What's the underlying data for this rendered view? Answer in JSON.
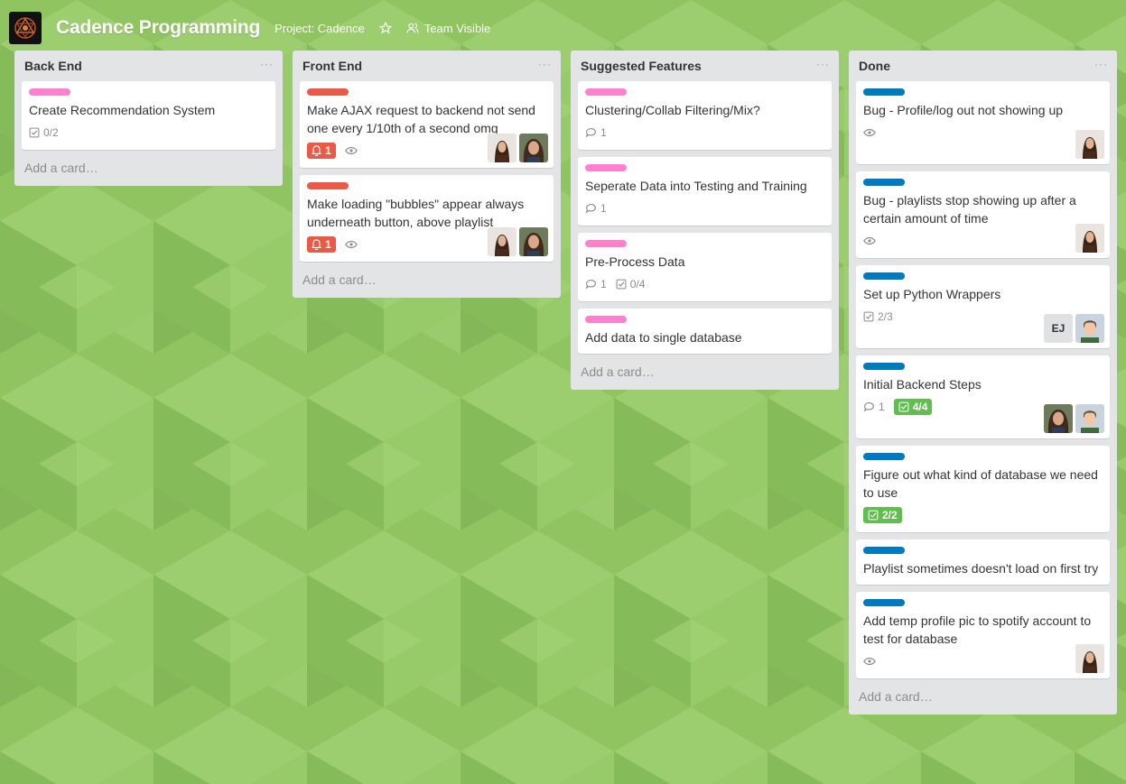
{
  "header": {
    "title": "Cadence Programming",
    "project": "Project: Cadence",
    "visibility": "Team Visible",
    "icons": [
      "cadence-logo",
      "star-icon",
      "team-icon"
    ]
  },
  "colors": {
    "pink": "#ff80ce",
    "red": "#eb5a46",
    "blue": "#0079bf",
    "green": "#61bd4f",
    "list_bg": "#e2e4e6"
  },
  "lists": [
    {
      "title": "Back End",
      "menu": "···",
      "add_card": "Add a card…",
      "cards": [
        {
          "label_color": "pink",
          "title": "Create Recommendation System",
          "checklist": "0/2"
        }
      ]
    },
    {
      "title": "Front End",
      "menu": "···",
      "add_card": "Add a card…",
      "cards": [
        {
          "label_color": "red",
          "title": "Make AJAX request to backend not send one every 1/10th of a second omg",
          "due": "1",
          "watched": true,
          "members": [
            "avatar-woman-1",
            "avatar-woman-2"
          ]
        },
        {
          "label_color": "red",
          "title": "Make loading \"bubbles\" appear always underneath button, above playlist",
          "due": "1",
          "watched": true,
          "members": [
            "avatar-woman-1",
            "avatar-woman-2"
          ]
        }
      ]
    },
    {
      "title": "Suggested Features",
      "menu": "···",
      "add_card": "Add a card…",
      "cards": [
        {
          "label_color": "pink",
          "title": "Clustering/Collab Filtering/Mix?",
          "comments": "1"
        },
        {
          "label_color": "pink",
          "title": "Seperate Data into Testing and Training",
          "comments": "1"
        },
        {
          "label_color": "pink",
          "title": "Pre-Process Data",
          "comments": "1",
          "checklist": "0/4"
        },
        {
          "label_color": "pink",
          "title": "Add data to single database"
        }
      ]
    },
    {
      "title": "Done",
      "menu": "···",
      "add_card": "Add a card…",
      "cards": [
        {
          "label_color": "blue",
          "title": "Bug - Profile/log out not showing up",
          "watched": true,
          "members": [
            "avatar-woman-1"
          ]
        },
        {
          "label_color": "blue",
          "title": "Bug - playlists stop showing up after a certain amount of time",
          "watched": true,
          "members": [
            "avatar-woman-1"
          ]
        },
        {
          "label_color": "blue",
          "title": "Set up Python Wrappers",
          "checklist": "2/3",
          "members_initials": "EJ",
          "members": [
            "avatar-man-1"
          ]
        },
        {
          "label_color": "blue",
          "title": "Initial Backend Steps",
          "comments": "1",
          "checklist_complete": "4/4",
          "members": [
            "avatar-woman-2",
            "avatar-man-1"
          ]
        },
        {
          "label_color": "blue",
          "title": "Figure out what kind of database we need to use",
          "checklist_complete": "2/2"
        },
        {
          "label_color": "blue",
          "title": "Playlist sometimes doesn't load on first try"
        },
        {
          "label_color": "blue",
          "title": "Add temp profile pic to spotify account to test for database",
          "watched": true,
          "members": [
            "avatar-woman-1"
          ]
        }
      ]
    }
  ]
}
